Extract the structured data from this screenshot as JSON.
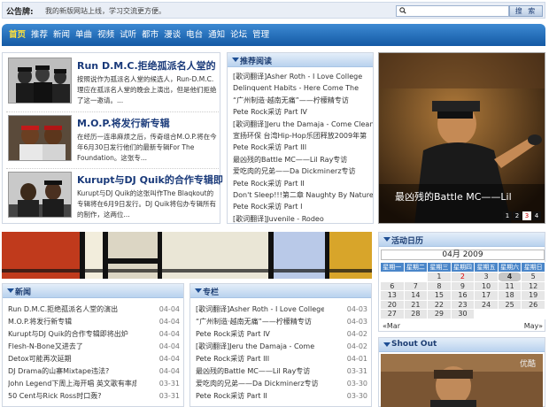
{
  "notice": {
    "label": "公告牌:",
    "text": "我的新版网站上线，学习交流更方便。"
  },
  "search": {
    "placeholder": "",
    "button": "搜 索"
  },
  "nav": [
    "首页",
    "推荐",
    "新闻",
    "单曲",
    "视频",
    "试听",
    "都市",
    "漫谈",
    "电台",
    "通知",
    "论坛",
    "管理"
  ],
  "featured": [
    {
      "title": "Run D.M.C.拒绝孤派名人堂的",
      "desc": "按照说作为孤派名人堂的候选人，Run-D.M.C.理应在孤派名人堂的晚会上演出，但是他们拒绝了这一邀请。..."
    },
    {
      "title": "M.O.P.将发行新专辑",
      "desc": "在经历一连串麻烦之后，传奇组合M.O.P.将在今年6月30日发行他们的最新专辑For The Foundation。这张专..."
    },
    {
      "title": "Kurupt与DJ Quik的合作专辑即",
      "desc": "Kurupt与DJ Quik的这张叫作The Blaqkout的专辑将在6月9日发行。DJ Quik将包办专辑所有的制作，这两位..."
    }
  ],
  "recommend": {
    "title": "推荐阅读",
    "items": [
      "[歌词翻译]Asher Roth - I Love College",
      "Delinquent Habits - Here Come The",
      "“广州制造·越南无痛”——柠檬精专访",
      "Pete Rock采访 Part IV",
      "[歌词翻译]Jeru the Damaja - Come Clean",
      "宣扬环保 台湾Hip-Hop乐团释放2009年第",
      "Pete Rock采访 Part III",
      "最凶残的Battle MC——Lil Ray专访",
      "爱吃肉的兄弟——Da Dickminerz专访",
      "Pete Rock采访 Part II",
      "Don't Sleep!!!第二章 Naughty By Nature",
      "Pete Rock采访 Part I",
      "[歌词翻译]Juvenile - Rodeo"
    ]
  },
  "photo": {
    "caption": "最凶残的Battle MC——Lil",
    "pager": [
      "1",
      "2",
      "3",
      "4"
    ],
    "active": "3"
  },
  "calendar": {
    "title": "活动日历",
    "month": "04月 2009",
    "weekdays": [
      "星期一",
      "星期二",
      "星期三",
      "星期四",
      "星期五",
      "星期六",
      "星期日"
    ],
    "weeks": [
      [
        "",
        "",
        "1",
        "2",
        "3",
        "4",
        "5"
      ],
      [
        "6",
        "7",
        "8",
        "9",
        "10",
        "11",
        "12"
      ],
      [
        "13",
        "14",
        "15",
        "16",
        "17",
        "18",
        "19"
      ],
      [
        "20",
        "21",
        "22",
        "23",
        "24",
        "25",
        "26"
      ],
      [
        "27",
        "28",
        "29",
        "30",
        "",
        "",
        ""
      ]
    ],
    "today": "4",
    "prev": "«Mar",
    "next": "May»"
  },
  "news": {
    "title": "新闻",
    "items": [
      {
        "t": "Run D.M.C.拒绝孤派名人堂的演出",
        "d": "04-04"
      },
      {
        "t": "M.O.P.将发行新专辑",
        "d": "04-04"
      },
      {
        "t": "Kurupt与DJ Quik的合作专辑即将出炉",
        "d": "04-04"
      },
      {
        "t": "Flesh-N-Bone又进去了",
        "d": "04-04"
      },
      {
        "t": "Detox可能再次延期",
        "d": "04-04"
      },
      {
        "t": "DJ Drama的山寨Mixtape违法?",
        "d": "04-04"
      },
      {
        "t": "John Legend下周上海开唱 英文歌有率成为",
        "d": "03-31"
      },
      {
        "t": "50 Cent与Rick Ross时口轰?",
        "d": "03-31"
      }
    ]
  },
  "column": {
    "title": "专栏",
    "items": [
      {
        "t": "[歌词翻译]Asher Roth - I Love College",
        "d": "04-03"
      },
      {
        "t": "“广州制造·越南无痛”——柠檬精专访",
        "d": "04-03"
      },
      {
        "t": "Pete Rock采访 Part IV",
        "d": "04-02"
      },
      {
        "t": "[歌词翻译]Jeru the Damaja - Come",
        "d": "04-02"
      },
      {
        "t": "Pete Rock采访 Part III",
        "d": "04-01"
      },
      {
        "t": "最凶残的Battle MC——Lil Ray专访",
        "d": "03-31"
      },
      {
        "t": "爱吃肉的兄弟——Da Dickminerz专访",
        "d": "03-30"
      },
      {
        "t": "Pete Rock采访 Part II",
        "d": "03-30"
      }
    ]
  },
  "shout": {
    "title": "Shout Out",
    "watermark": "优酷"
  },
  "colors": {
    "nav": "#1f6bbd",
    "navActive": "#ffe23a",
    "title": "#1a3a7a",
    "calHeader": "#4a86c9"
  }
}
